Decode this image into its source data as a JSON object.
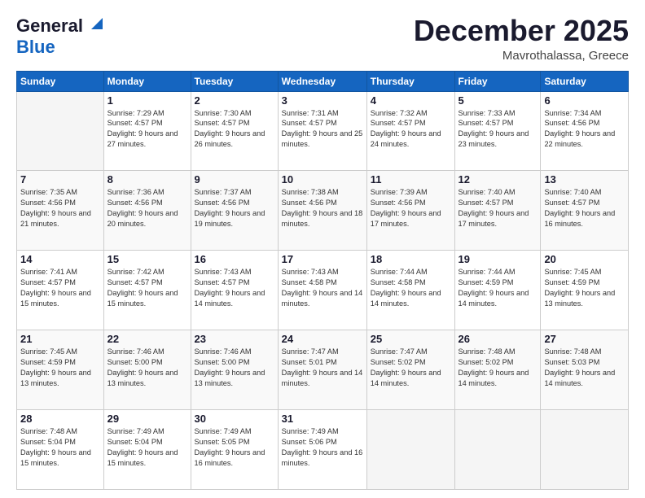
{
  "logo": {
    "line1": "General",
    "line2": "Blue"
  },
  "header": {
    "month": "December 2025",
    "location": "Mavrothalassa, Greece"
  },
  "weekdays": [
    "Sunday",
    "Monday",
    "Tuesday",
    "Wednesday",
    "Thursday",
    "Friday",
    "Saturday"
  ],
  "weeks": [
    [
      {
        "day": "",
        "empty": true
      },
      {
        "day": "1",
        "sunrise": "7:29 AM",
        "sunset": "4:57 PM",
        "daylight": "9 hours and 27 minutes."
      },
      {
        "day": "2",
        "sunrise": "7:30 AM",
        "sunset": "4:57 PM",
        "daylight": "9 hours and 26 minutes."
      },
      {
        "day": "3",
        "sunrise": "7:31 AM",
        "sunset": "4:57 PM",
        "daylight": "9 hours and 25 minutes."
      },
      {
        "day": "4",
        "sunrise": "7:32 AM",
        "sunset": "4:57 PM",
        "daylight": "9 hours and 24 minutes."
      },
      {
        "day": "5",
        "sunrise": "7:33 AM",
        "sunset": "4:57 PM",
        "daylight": "9 hours and 23 minutes."
      },
      {
        "day": "6",
        "sunrise": "7:34 AM",
        "sunset": "4:56 PM",
        "daylight": "9 hours and 22 minutes."
      }
    ],
    [
      {
        "day": "7",
        "sunrise": "7:35 AM",
        "sunset": "4:56 PM",
        "daylight": "9 hours and 21 minutes."
      },
      {
        "day": "8",
        "sunrise": "7:36 AM",
        "sunset": "4:56 PM",
        "daylight": "9 hours and 20 minutes."
      },
      {
        "day": "9",
        "sunrise": "7:37 AM",
        "sunset": "4:56 PM",
        "daylight": "9 hours and 19 minutes."
      },
      {
        "day": "10",
        "sunrise": "7:38 AM",
        "sunset": "4:56 PM",
        "daylight": "9 hours and 18 minutes."
      },
      {
        "day": "11",
        "sunrise": "7:39 AM",
        "sunset": "4:56 PM",
        "daylight": "9 hours and 17 minutes."
      },
      {
        "day": "12",
        "sunrise": "7:40 AM",
        "sunset": "4:57 PM",
        "daylight": "9 hours and 17 minutes."
      },
      {
        "day": "13",
        "sunrise": "7:40 AM",
        "sunset": "4:57 PM",
        "daylight": "9 hours and 16 minutes."
      }
    ],
    [
      {
        "day": "14",
        "sunrise": "7:41 AM",
        "sunset": "4:57 PM",
        "daylight": "9 hours and 15 minutes."
      },
      {
        "day": "15",
        "sunrise": "7:42 AM",
        "sunset": "4:57 PM",
        "daylight": "9 hours and 15 minutes."
      },
      {
        "day": "16",
        "sunrise": "7:43 AM",
        "sunset": "4:57 PM",
        "daylight": "9 hours and 14 minutes."
      },
      {
        "day": "17",
        "sunrise": "7:43 AM",
        "sunset": "4:58 PM",
        "daylight": "9 hours and 14 minutes."
      },
      {
        "day": "18",
        "sunrise": "7:44 AM",
        "sunset": "4:58 PM",
        "daylight": "9 hours and 14 minutes."
      },
      {
        "day": "19",
        "sunrise": "7:44 AM",
        "sunset": "4:59 PM",
        "daylight": "9 hours and 14 minutes."
      },
      {
        "day": "20",
        "sunrise": "7:45 AM",
        "sunset": "4:59 PM",
        "daylight": "9 hours and 13 minutes."
      }
    ],
    [
      {
        "day": "21",
        "sunrise": "7:45 AM",
        "sunset": "4:59 PM",
        "daylight": "9 hours and 13 minutes."
      },
      {
        "day": "22",
        "sunrise": "7:46 AM",
        "sunset": "5:00 PM",
        "daylight": "9 hours and 13 minutes."
      },
      {
        "day": "23",
        "sunrise": "7:46 AM",
        "sunset": "5:00 PM",
        "daylight": "9 hours and 13 minutes."
      },
      {
        "day": "24",
        "sunrise": "7:47 AM",
        "sunset": "5:01 PM",
        "daylight": "9 hours and 14 minutes."
      },
      {
        "day": "25",
        "sunrise": "7:47 AM",
        "sunset": "5:02 PM",
        "daylight": "9 hours and 14 minutes."
      },
      {
        "day": "26",
        "sunrise": "7:48 AM",
        "sunset": "5:02 PM",
        "daylight": "9 hours and 14 minutes."
      },
      {
        "day": "27",
        "sunrise": "7:48 AM",
        "sunset": "5:03 PM",
        "daylight": "9 hours and 14 minutes."
      }
    ],
    [
      {
        "day": "28",
        "sunrise": "7:48 AM",
        "sunset": "5:04 PM",
        "daylight": "9 hours and 15 minutes."
      },
      {
        "day": "29",
        "sunrise": "7:49 AM",
        "sunset": "5:04 PM",
        "daylight": "9 hours and 15 minutes."
      },
      {
        "day": "30",
        "sunrise": "7:49 AM",
        "sunset": "5:05 PM",
        "daylight": "9 hours and 16 minutes."
      },
      {
        "day": "31",
        "sunrise": "7:49 AM",
        "sunset": "5:06 PM",
        "daylight": "9 hours and 16 minutes."
      },
      {
        "day": "",
        "empty": true
      },
      {
        "day": "",
        "empty": true
      },
      {
        "day": "",
        "empty": true
      }
    ]
  ]
}
